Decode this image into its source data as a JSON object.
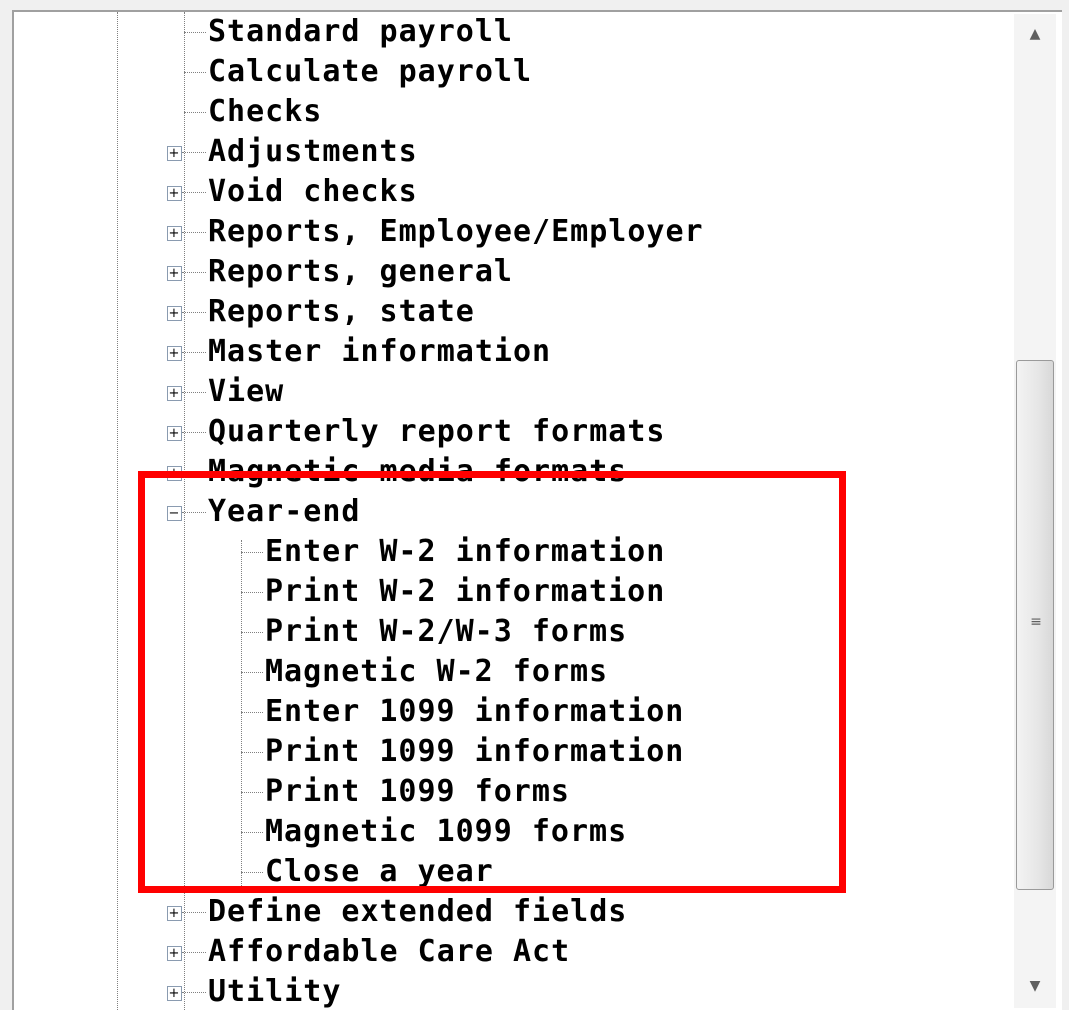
{
  "tree": {
    "items": [
      {
        "label": "Standard payroll"
      },
      {
        "label": "Calculate payroll"
      },
      {
        "label": "Checks"
      },
      {
        "label": "Adjustments",
        "expander": "+"
      },
      {
        "label": "Void checks",
        "expander": "+"
      },
      {
        "label": "Reports, Employee/Employer",
        "expander": "+"
      },
      {
        "label": "Reports, general",
        "expander": "+"
      },
      {
        "label": "Reports, state",
        "expander": "+"
      },
      {
        "label": "Master information",
        "expander": "+"
      },
      {
        "label": "View",
        "expander": "+"
      },
      {
        "label": "Quarterly report formats",
        "expander": "+"
      },
      {
        "label": "Magnetic media formats",
        "expander": "+"
      },
      {
        "label": "Year-end",
        "expander": "−"
      },
      {
        "label": "Enter W-2 information"
      },
      {
        "label": "Print W-2 information"
      },
      {
        "label": "Print W-2/W-3 forms"
      },
      {
        "label": "Magnetic W-2 forms"
      },
      {
        "label": "Enter 1099 information"
      },
      {
        "label": "Print 1099 information"
      },
      {
        "label": "Print 1099 forms"
      },
      {
        "label": "Magnetic 1099 forms"
      },
      {
        "label": "Close a year"
      },
      {
        "label": "Define extended fields",
        "expander": "+"
      },
      {
        "label": "Affordable Care Act",
        "expander": "+"
      },
      {
        "label": "Utility",
        "expander": "+"
      }
    ]
  },
  "scrollbar": {
    "up_icon": "▲",
    "down_icon": "▼",
    "grip_icon": "≡"
  },
  "colors": {
    "highlight": "#ff0000",
    "text": "#000000"
  }
}
